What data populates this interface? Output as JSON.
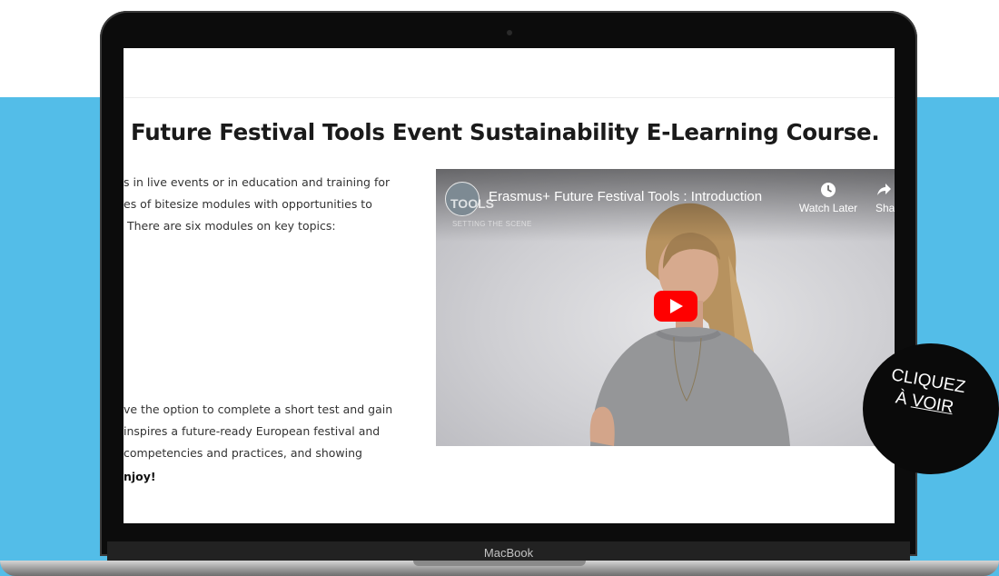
{
  "page": {
    "background_color": "#53bde8",
    "laptop_label": "MacBook"
  },
  "course": {
    "title": "Future Festival Tools Event Sustainability E-Learning Course.",
    "intro_lines": [
      "s in live events or in education and training for",
      "es of bitesize modules with opportunities to",
      "There are six modules on key topics:"
    ],
    "outro_lines": [
      "ve the option to complete a short test and gain",
      "inspires a future-ready European festival and",
      "competencies and practices, and showing",
      "njoy!"
    ]
  },
  "video": {
    "title": "Erasmus+ Future Festival Tools : Introduction",
    "watch_later_label": "Watch Later",
    "share_label": "Sha",
    "channel_watermark": "TOOLS",
    "channel_subtitle": "SETTING THE SCENE",
    "icons": {
      "watch_later": "clock-icon",
      "share": "share-arrow-icon",
      "play": "youtube-play-icon"
    },
    "play_button_color": "#ff0000"
  },
  "badge": {
    "line1": "CLIQUEZ",
    "line2_prefix": "À ",
    "line2_link": "VOIR"
  }
}
